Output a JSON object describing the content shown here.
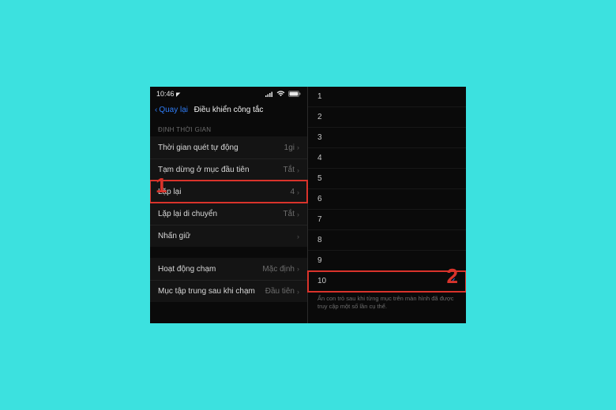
{
  "status": {
    "time": "10:46",
    "loc_icon": "◤"
  },
  "nav": {
    "back": "Quay lại",
    "title": "Điều khiển công tắc"
  },
  "section": "ĐỊNH THỜI GIAN",
  "rows1": [
    {
      "label": "Thời gian quét tự động",
      "value": "1gi"
    },
    {
      "label": "Tạm dừng ở mục đầu tiên",
      "value": "Tắt"
    },
    {
      "label": "Lặp lại",
      "value": "4",
      "hl": true
    },
    {
      "label": "Lặp lại di chuyển",
      "value": "Tắt"
    },
    {
      "label": "Nhấn giữ",
      "value": ""
    }
  ],
  "rows2": [
    {
      "label": "Hoạt động chạm",
      "value": "Mặc định"
    },
    {
      "label": "Mục tập trung sau khi chạm",
      "value": "Đầu tiên"
    }
  ],
  "nums": [
    "1",
    "2",
    "3",
    "4",
    "5",
    "6",
    "7",
    "8",
    "9",
    "10"
  ],
  "selected": "10",
  "footer": "Ẩn con trỏ sau khi từng mục trên màn hình đã được truy cập một số lần cụ thể.",
  "anno": {
    "one": "1",
    "two": "2"
  }
}
